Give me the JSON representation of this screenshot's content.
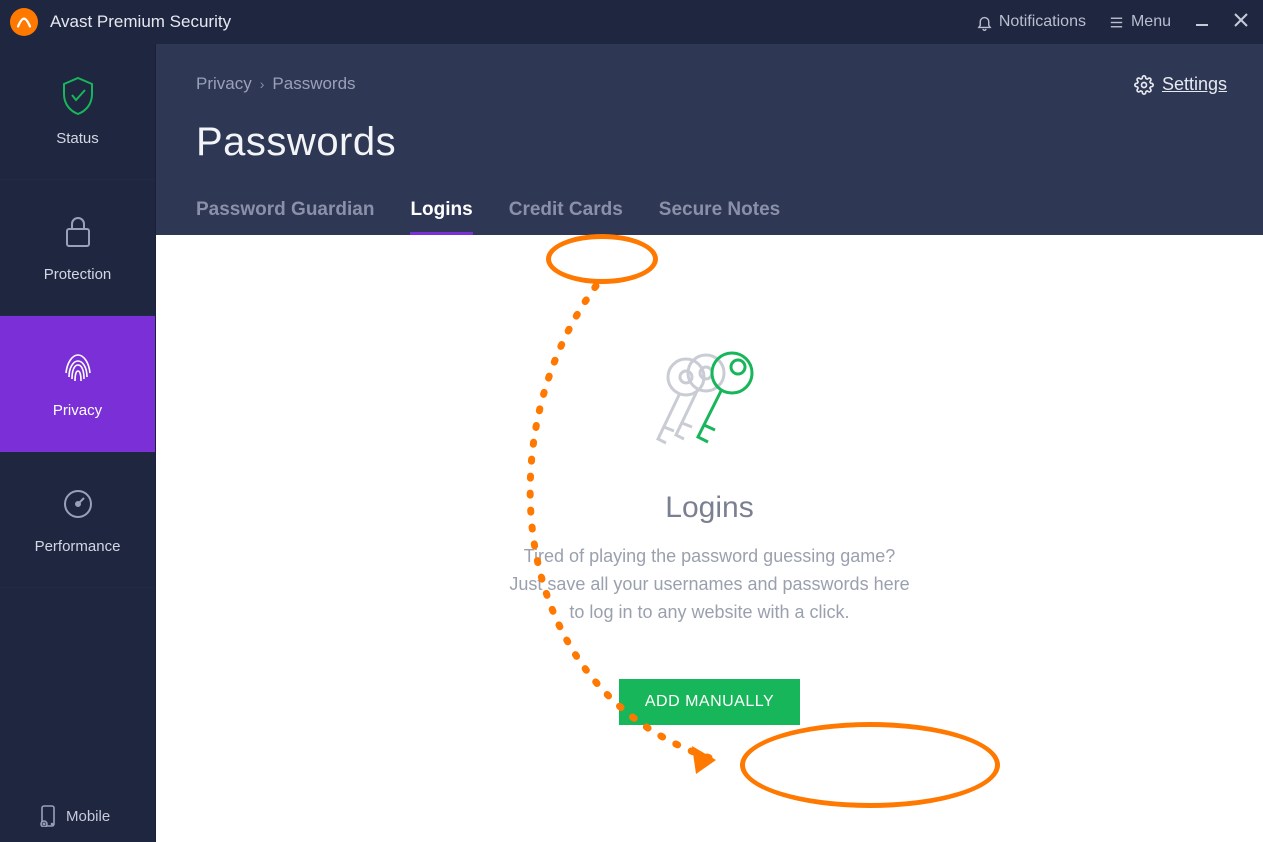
{
  "app": {
    "title": "Avast Premium Security"
  },
  "titlebar": {
    "notifications": "Notifications",
    "menu": "Menu"
  },
  "sidebar": {
    "items": [
      {
        "label": "Status"
      },
      {
        "label": "Protection"
      },
      {
        "label": "Privacy"
      },
      {
        "label": "Performance"
      }
    ],
    "mobile": "Mobile"
  },
  "header": {
    "breadcrumb_root": "Privacy",
    "breadcrumb_current": "Passwords",
    "title": "Passwords",
    "settings": "Settings"
  },
  "tabs": [
    {
      "label": "Password Guardian"
    },
    {
      "label": "Logins"
    },
    {
      "label": "Credit Cards"
    },
    {
      "label": "Secure Notes"
    }
  ],
  "empty": {
    "title": "Logins",
    "line1": "Tired of playing the password guessing game?",
    "line2": "Just save all your usernames and passwords here",
    "line3": "to log in to any website with a click.",
    "button": "ADD MANUALLY"
  },
  "annotations": {
    "highlight_tab_index": 1,
    "highlight_button": true
  }
}
